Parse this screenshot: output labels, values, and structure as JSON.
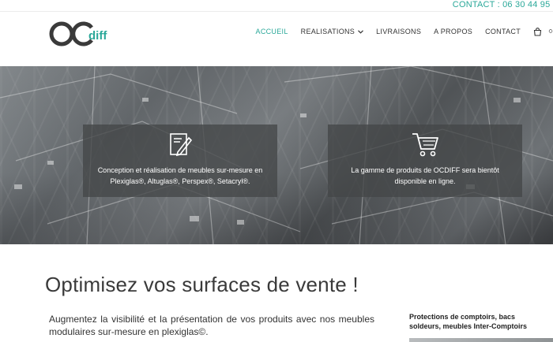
{
  "topbar": {
    "contact": "CONTACT : 06 30 44 95 9"
  },
  "brand": {
    "logo_text": "OC",
    "logo_suffix": "diff",
    "accent": "#2aa899"
  },
  "nav": {
    "items": [
      {
        "label": "ACCUEIL",
        "active": true
      },
      {
        "label": "REALISATIONS",
        "has_dropdown": true
      },
      {
        "label": "LIVRAISONS"
      },
      {
        "label": "A PROPOS"
      },
      {
        "label": "CONTACT"
      }
    ],
    "icons": [
      "cart-icon",
      "search-icon"
    ]
  },
  "hero": {
    "cards": [
      {
        "icon": "design-pencil-icon",
        "text": "Conception et réalisation de meubles sur-mesure en Plexiglas®, Altuglas®, Perspex®, Setacryl®."
      },
      {
        "icon": "shopping-cart-icon",
        "text": "La gamme de produits de OCDIFF sera bientôt disponible en ligne."
      }
    ]
  },
  "main": {
    "headline": "Optimisez vos surfaces de vente !",
    "intro": "Augmentez la visibilité et la présentation de vos produits avec nos meubles modulaires sur-mesure en plexiglas©."
  },
  "sidebar": {
    "title": "Protections de comptoirs, bacs soldeurs, meubles Inter-Comptoirs"
  }
}
